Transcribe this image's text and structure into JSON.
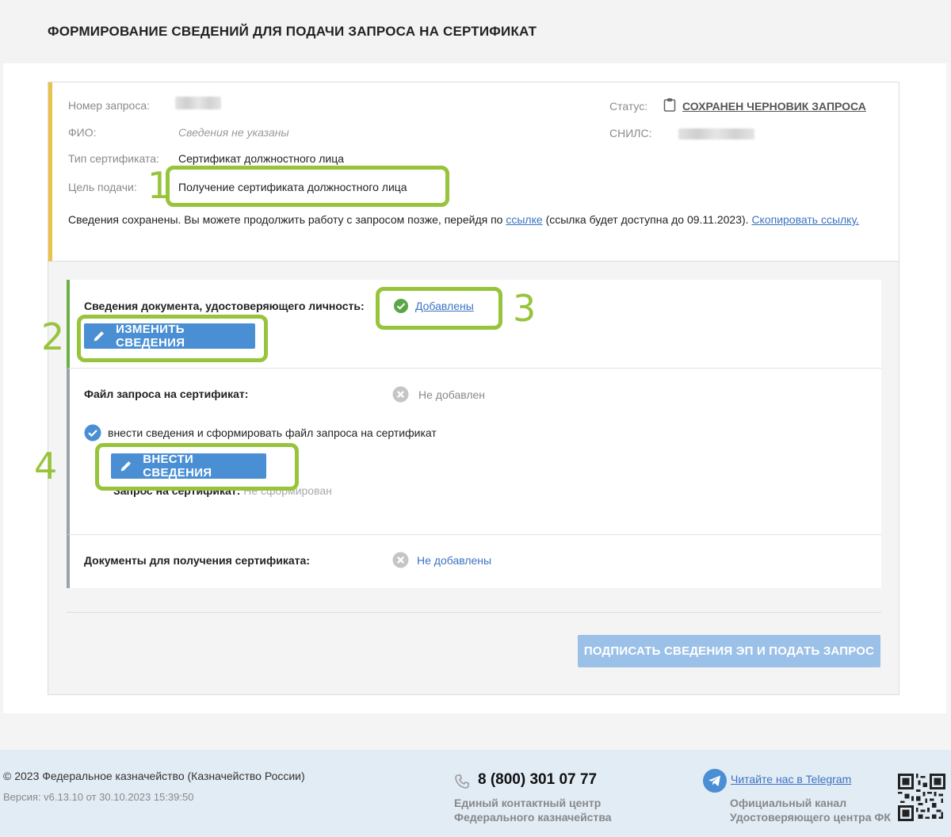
{
  "page": {
    "title": "ФОРМИРОВАНИЕ СВЕДЕНИЙ ДЛЯ ПОДАЧИ ЗАПРОСА НА СЕРТИФИКАТ"
  },
  "request_info": {
    "number_label": "Номер запроса:",
    "fio_label": "ФИО:",
    "fio_value": "Сведения не указаны",
    "cert_type_label": "Тип сертификата:",
    "cert_type_value": "Сертификат должностного лица",
    "purpose_label": "Цель подачи:",
    "purpose_value": "Получение сертификата должностного лица",
    "status_label": "Статус:",
    "status_value": "СОХРАНЕН ЧЕРНОВИК ЗАПРОСА",
    "snils_label": "СНИЛС:",
    "saved_note_prefix": "Сведения сохранены. Вы можете продолжить работу с запросом позже, перейдя по",
    "saved_note_link": "ссылке",
    "saved_note_middle": "(ссылка будет доступна до 09.11.2023).",
    "copy_link": "Скопировать ссылку."
  },
  "sections": {
    "identity": {
      "title": "Сведения документа, удостоверяющего личность:",
      "status": "Добавлены",
      "button": "ИЗМЕНИТЬ СВЕДЕНИЯ"
    },
    "request_file": {
      "title": "Файл запроса на сертификат:",
      "status": "Не добавлен",
      "option": "внести сведения и сформировать файл запроса на сертификат",
      "button": "ВНЕСТИ СВЕДЕНИЯ",
      "request_label": "Запрос на сертификат:",
      "request_status": "Не сформирован"
    },
    "documents": {
      "title": "Документы для получения сертификата:",
      "status": "Не добавлены"
    }
  },
  "submit_button": "ПОДПИСАТЬ СВЕДЕНИЯ ЭП И ПОДАТЬ ЗАПРОС",
  "annotations": [
    "1",
    "2",
    "3",
    "4"
  ],
  "footer": {
    "copyright": "© 2023 Федеральное казначейство (Казначейство России)",
    "version": "Версия: v6.13.10 от 30.10.2023 15:39:50",
    "phone": "8 (800) 301 07 77",
    "contact_center_line1": "Единый контактный центр",
    "contact_center_line2": "Федерального казначейства",
    "telegram_link": "Читайте нас в Telegram",
    "channel_line1": "Официальный канал",
    "channel_line2": "Удостоверяющего центра ФК"
  },
  "colors": {
    "accent_blue": "#4a8fd4",
    "highlight_green": "#97c43b",
    "info_border_yellow": "#e9c24a",
    "success_green": "#6caf47"
  },
  "icons": [
    "clipboard-icon",
    "check-circle-icon",
    "pencil-icon",
    "x-circle-icon",
    "checkbox-checked-icon",
    "phone-icon",
    "telegram-icon",
    "qr-code-icon"
  ]
}
